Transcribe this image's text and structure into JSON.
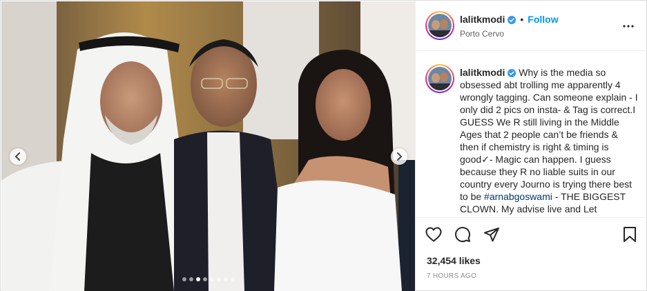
{
  "post": {
    "username": "lalitkmodi",
    "follow_label": "Follow",
    "separator": "•",
    "location": "Porto Cervo",
    "verified": true,
    "caption_pre": "Why is the media so obsessed abt trolling me apparently 4 wrongly tagging. Can someone explain - I only did 2 pics on insta- & Tag is correct.I GUESS We R still living in the Middle Ages that 2 people can’t be friends & then if chemistry is right & timing is good✓- Magic can happen. I guess because they R no liable suits in our country every Journo is trying there best to be ",
    "hashtag": "#arnabgoswami",
    "caption_post": " - THE BIGGEST CLOWN. My advise live and Let",
    "likes_text": "32,454 likes",
    "timestamp": "7 HOURS AGO",
    "carousel": {
      "count": 8,
      "active_index": 2
    }
  },
  "colors": {
    "accent": "#0095f6",
    "hashtag": "#00376b",
    "verified": "#3897f0",
    "muted": "#8e8e8e"
  },
  "icons": {
    "nav_prev": "chevron-left-icon",
    "nav_next": "chevron-right-icon",
    "more": "more-horizontal-icon",
    "like": "heart-icon",
    "comment": "comment-bubble-icon",
    "share": "paper-plane-icon",
    "save": "bookmark-icon"
  }
}
